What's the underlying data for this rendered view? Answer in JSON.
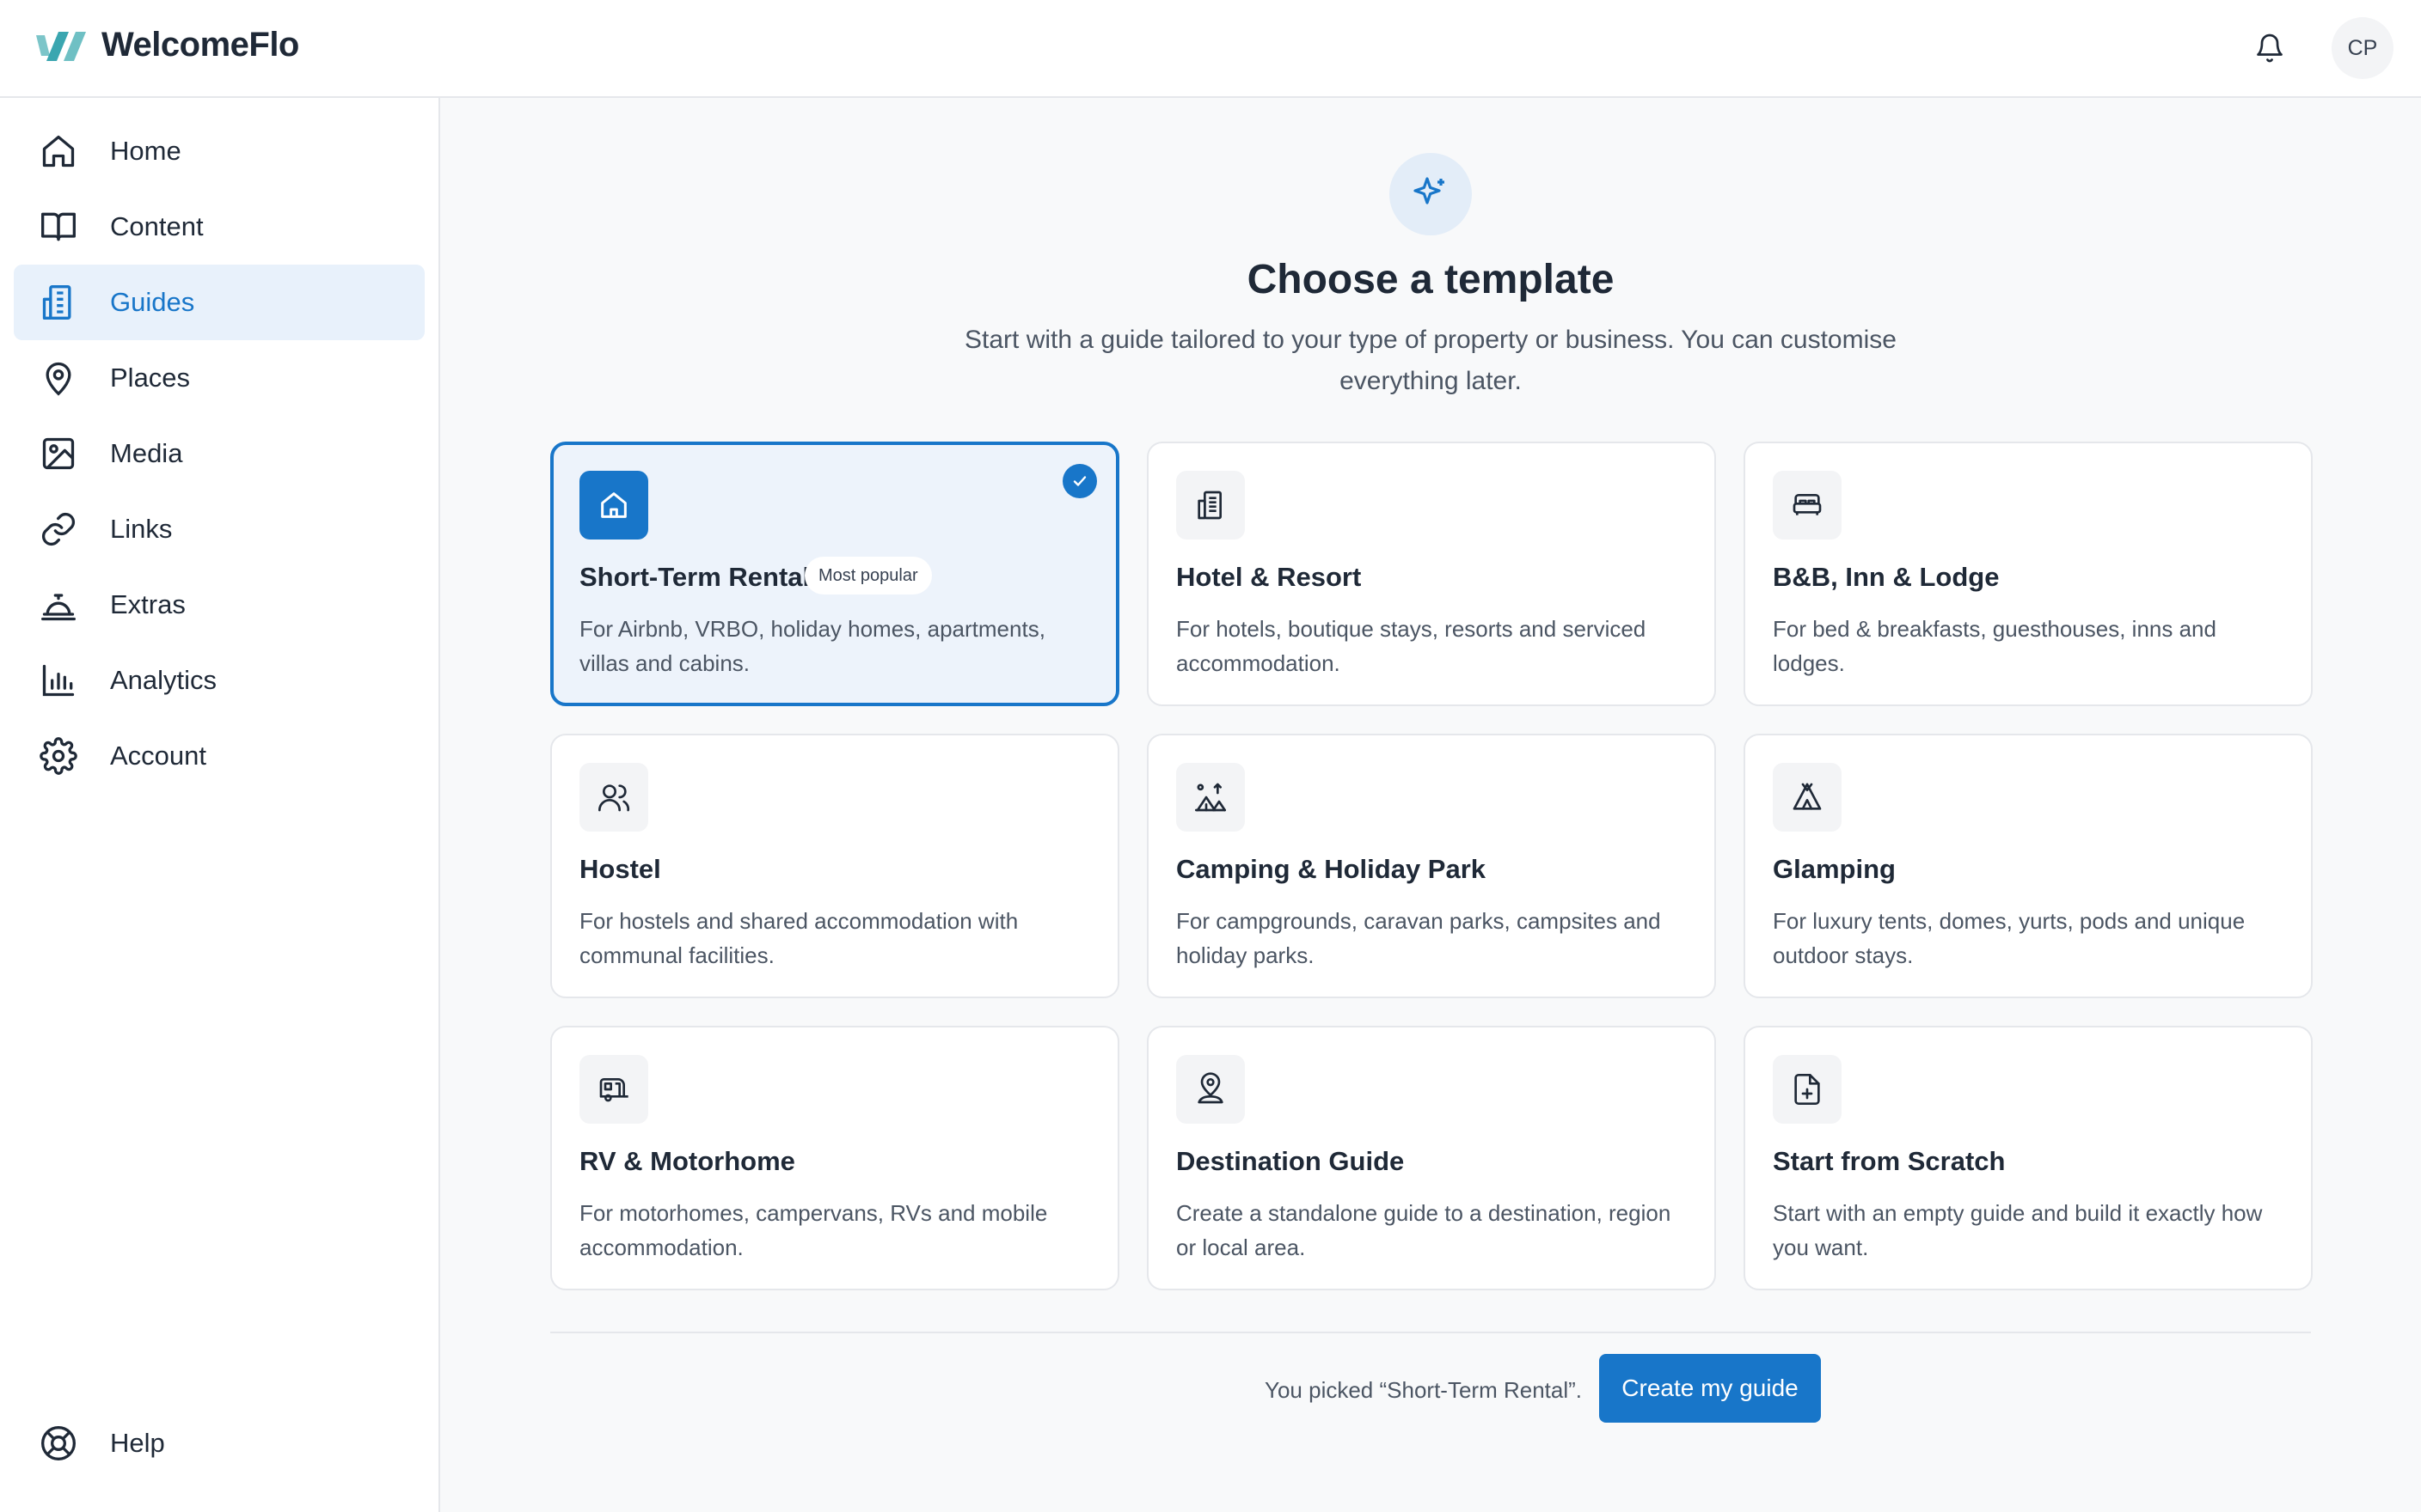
{
  "app": {
    "name": "WelcomeFlo"
  },
  "header": {
    "avatar_initials": "CP"
  },
  "sidebar": {
    "items": [
      {
        "label": "Home",
        "icon": "home-icon"
      },
      {
        "label": "Content",
        "icon": "book-open-icon"
      },
      {
        "label": "Guides",
        "icon": "building-icon",
        "active": true
      },
      {
        "label": "Places",
        "icon": "map-pin-icon"
      },
      {
        "label": "Media",
        "icon": "image-icon"
      },
      {
        "label": "Links",
        "icon": "link-icon"
      },
      {
        "label": "Extras",
        "icon": "concierge-bell-icon"
      },
      {
        "label": "Analytics",
        "icon": "bar-chart-icon"
      },
      {
        "label": "Account",
        "icon": "gear-icon"
      }
    ],
    "help_label": "Help"
  },
  "main": {
    "title": "Choose a template",
    "subtitle": "Start with a guide tailored to your type of property or business. You can customise everything later.",
    "cards": [
      {
        "title": "Short-Term Rental",
        "badge": "Most popular",
        "desc": "For Airbnb, VRBO, holiday homes, apartments, villas and cabins.",
        "icon": "house-icon",
        "selected": true
      },
      {
        "title": "Hotel & Resort",
        "desc": "For hotels, boutique stays, resorts and serviced accommodation.",
        "icon": "hotel-icon"
      },
      {
        "title": "B&B, Inn & Lodge",
        "desc": "For bed & breakfasts, guesthouses, inns and lodges.",
        "icon": "bed-icon"
      },
      {
        "title": "Hostel",
        "desc": "For hostels and shared accommodation with communal facilities.",
        "icon": "users-icon"
      },
      {
        "title": "Camping & Holiday Park",
        "desc": "For campgrounds, caravan parks, campsites and holiday parks.",
        "icon": "campsite-icon"
      },
      {
        "title": "Glamping",
        "desc": "For luxury tents, domes, yurts, pods and unique outdoor stays.",
        "icon": "tent-icon"
      },
      {
        "title": "RV & Motorhome",
        "desc": "For motorhomes, campervans, RVs and mobile accommodation.",
        "icon": "caravan-icon"
      },
      {
        "title": "Destination Guide",
        "desc": "Create a standalone guide to a destination, region or local area.",
        "icon": "map-pin-user-icon"
      },
      {
        "title": "Start from Scratch",
        "desc": "Start with an empty guide and build it exactly how you want.",
        "icon": "file-plus-icon"
      }
    ]
  },
  "footer": {
    "picked_text": "You picked “Short-Term Rental”.",
    "create_label": "Create my guide"
  },
  "colors": {
    "accent": "#1876c9",
    "active_bg": "#e8f1fb",
    "selected_card_bg": "#edf3fb"
  }
}
